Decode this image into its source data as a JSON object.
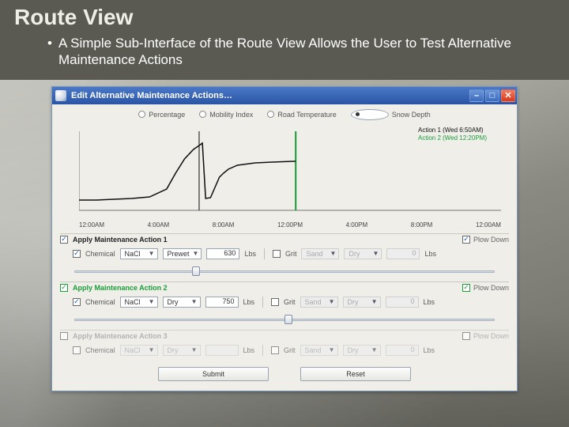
{
  "slide": {
    "title": "Route View",
    "bullet": "A Simple Sub-Interface of the Route View Allows the User to Test Alternative Maintenance Actions"
  },
  "window": {
    "title": "Edit Alternative Maintenance Actions…"
  },
  "metrics": {
    "options": [
      "Percentage",
      "Mobility Index",
      "Road Temperature",
      "Snow Depth"
    ],
    "selected": 3
  },
  "chart_legend": {
    "action1": "Action 1 (Wed 6:50AM)",
    "action2": "Action 2 (Wed 12:20PM)"
  },
  "chart_data": {
    "type": "line",
    "title": "",
    "xlabel": "",
    "ylabel": "",
    "ylim": [
      0,
      2
    ],
    "xlim": [
      0,
      24
    ],
    "x_ticks": [
      "12:00AM",
      "4:00AM",
      "8:00AM",
      "12:00PM",
      "4:00PM",
      "8:00PM",
      "12:00AM"
    ],
    "y_ticks": [
      0,
      1,
      2
    ],
    "series": [
      {
        "name": "Action 1 (Wed 6:50AM)",
        "color": "#111111",
        "x": [
          0,
          1,
          2,
          3,
          4,
          5,
          5.5,
          6,
          6.5,
          6.83,
          7,
          7.2,
          7.5,
          8,
          8.2,
          8.5,
          9,
          10,
          11,
          12.2,
          12.33
        ],
        "values": [
          0.25,
          0.25,
          0.28,
          0.3,
          0.35,
          0.55,
          0.95,
          1.3,
          1.55,
          1.65,
          1.7,
          0.3,
          0.32,
          0.85,
          0.95,
          1.05,
          1.15,
          1.2,
          1.22,
          1.25,
          1.25
        ]
      }
    ],
    "vlines": [
      {
        "x": 6.83,
        "color": "#111111",
        "label": "Action 1"
      },
      {
        "x": 12.33,
        "color": "#1a9e3a",
        "label": "Action 2"
      }
    ]
  },
  "actions": [
    {
      "enabled": true,
      "title": "Apply Maintenance Action 1",
      "plow_label": "Plow Down",
      "plow_enabled": true,
      "chemical_label": "Chemical",
      "chemical_enabled": true,
      "chem": "NaCl",
      "form": "Prewet",
      "rate": "630",
      "rate_unit": "Lbs",
      "grit_enabled": false,
      "grit_label": "Grit",
      "grit_type": "Sand",
      "grit_form": "Dry",
      "grit_rate": "0",
      "grit_unit": "Lbs",
      "slider_pct": 29
    },
    {
      "enabled": true,
      "title": "Apply Maintenance Action 2",
      "plow_label": "Plow Down",
      "plow_enabled": true,
      "chemical_label": "Chemical",
      "chemical_enabled": true,
      "chem": "NaCl",
      "form": "Dry",
      "rate": "750",
      "rate_unit": "Lbs",
      "grit_enabled": false,
      "grit_label": "Grit",
      "grit_type": "Sand",
      "grit_form": "Dry",
      "grit_rate": "0",
      "grit_unit": "Lbs",
      "slider_pct": 51
    },
    {
      "enabled": false,
      "title": "Apply Maintenance Action 3",
      "plow_label": "Plow Down",
      "plow_enabled": false,
      "chemical_label": "Chemical",
      "chemical_enabled": false,
      "chem": "NaCl",
      "form": "Dry",
      "rate": "",
      "rate_unit": "Lbs",
      "grit_enabled": false,
      "grit_label": "Grit",
      "grit_type": "Sand",
      "grit_form": "Dry",
      "grit_rate": "0",
      "grit_unit": "Lbs",
      "slider_pct": null
    }
  ],
  "buttons": {
    "submit": "Submit",
    "reset": "Reset"
  }
}
